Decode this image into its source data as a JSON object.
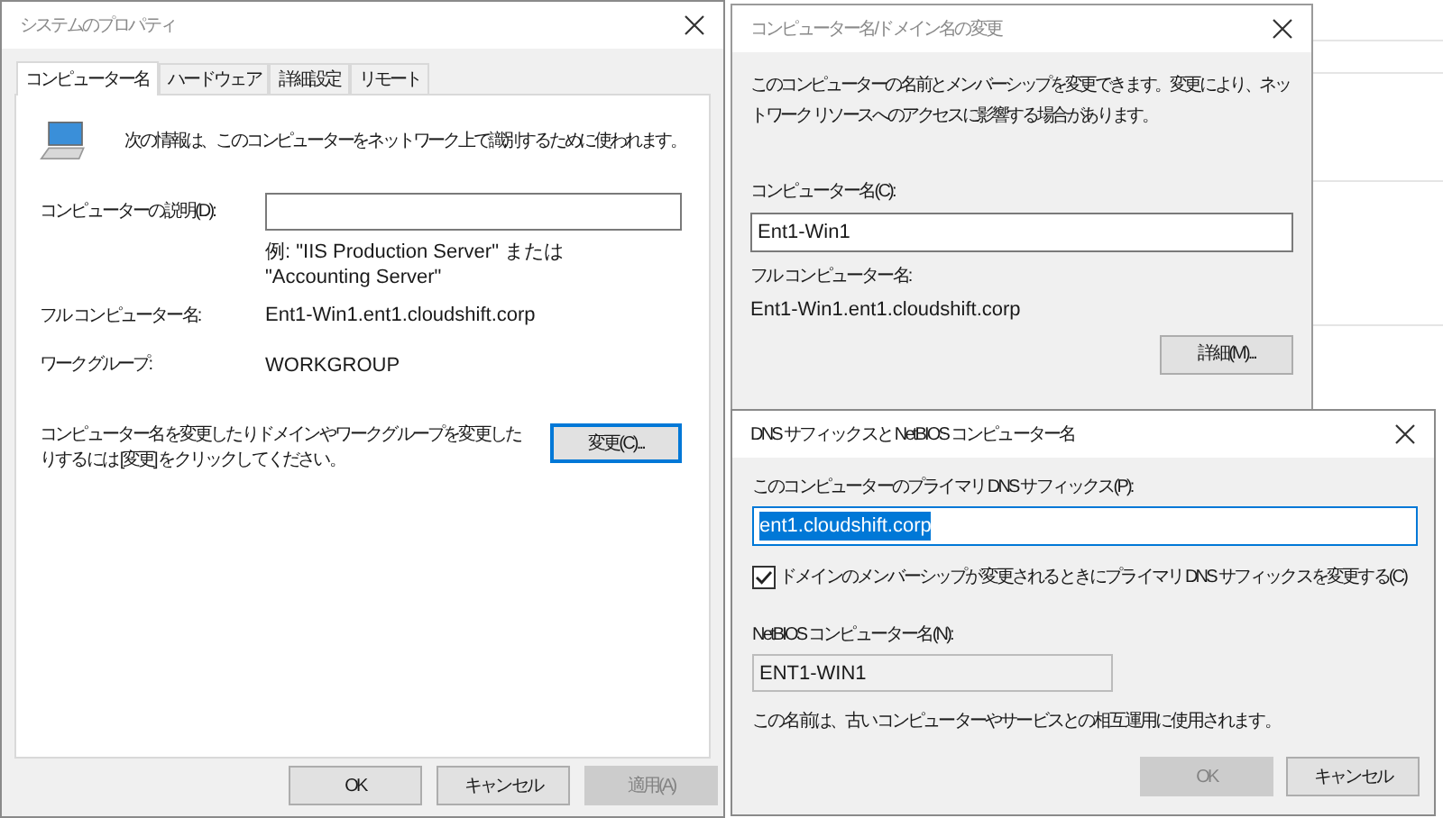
{
  "system_properties": {
    "title": "システムのプロパティ",
    "tabs": [
      {
        "label": "コンピューター名",
        "selected": true
      },
      {
        "label": "ハードウェア",
        "selected": false
      },
      {
        "label": "詳細設定",
        "selected": false
      },
      {
        "label": "リモート",
        "selected": false
      }
    ],
    "intro": "次の情報は、このコンピューターをネットワーク上で識別するために使われます。",
    "description_label": "コンピューターの説明(D):",
    "example": "例: \"IIS Production Server\" または \"Accounting Server\"",
    "info_rows": [
      {
        "label": "フル コンピューター名:",
        "value": "Ent1-Win1.ent1.cloudshift.corp"
      },
      {
        "label": "ワークグループ:",
        "value": "WORKGROUP"
      }
    ],
    "change_text": "コンピューター名を変更したりドメインやワークグループを変更したりするには [変更] をクリックしてください。",
    "change_button": "変更(C)...",
    "buttons": [
      {
        "label": "OK",
        "disabled": false
      },
      {
        "label": "キャンセル",
        "disabled": false
      },
      {
        "label": "適用(A)",
        "disabled": true
      }
    ]
  },
  "name_change_dialog": {
    "title": "コンピューター名/ドメイン名の変更",
    "intro": "このコンピューターの名前とメンバーシップを変更できます。変更により、ネットワーク リソースへのアクセスに影響する場合があります。",
    "name_label": "コンピューター名(C):",
    "name_field": {
      "value": "Ent1-Win1"
    },
    "full_name_label": "フル コンピューター名:",
    "full_name": "Ent1-Win1.ent1.cloudshift.corp",
    "more_button": "詳細(M)..."
  },
  "dns_dialog": {
    "title": "DNS サフィックスと NetBIOS コンピューター名",
    "suffix_label": "このコンピューターのプライマリ DNS サフィックス(P):",
    "suffix_field": {
      "value": "ent1.cloudshift.corp",
      "text_selected": true
    },
    "checkbox": {
      "label": "ドメインのメンバーシップが変更されるときにプライマリ DNS サフィックスを変更する(C)",
      "checked": true
    },
    "netbios_label": "NetBIOS コンピューター名(N):",
    "netbios_field": {
      "value": "ENT1-WIN1",
      "disabled": true
    },
    "note": "この名前は、古いコンピューターやサービスとの相互運用に使用されます。",
    "buttons": [
      {
        "label": "OK",
        "disabled": true
      },
      {
        "label": "キャンセル",
        "disabled": false
      }
    ]
  }
}
